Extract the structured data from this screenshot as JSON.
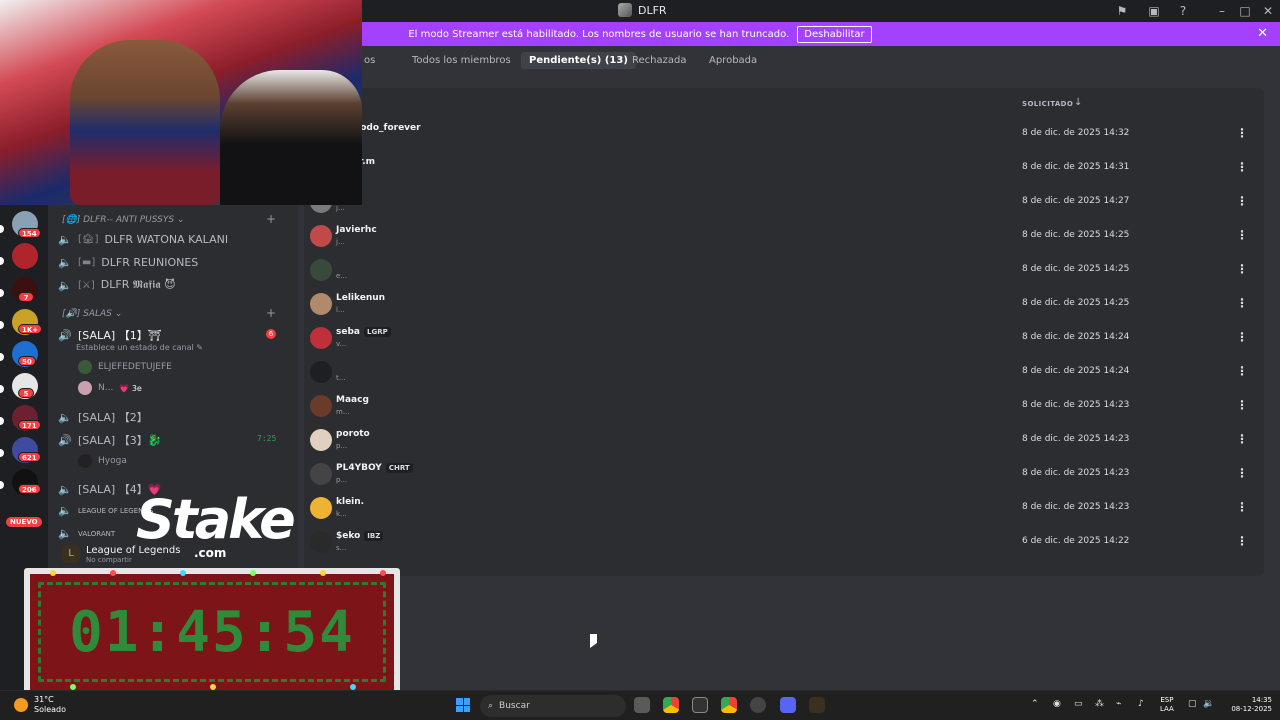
{
  "window": {
    "title": "DLFR"
  },
  "banner": {
    "message": "El modo Streamer está habilitado. Los nombres de usuario se han truncado.",
    "disable_label": "Deshabilitar"
  },
  "tabs": [
    {
      "label": "os"
    },
    {
      "label": "Todos los miembros"
    },
    {
      "label": "Pendiente(s) (13)",
      "active": true
    },
    {
      "label": "Rechazada"
    },
    {
      "label": "Aprobada"
    }
  ],
  "table": {
    "column_header": "SOLICITADO",
    "rows": [
      {
        "name": "pezgodo_forever",
        "sub": "",
        "date": "8 de dic. de 2025 14:32",
        "badge": ""
      },
      {
        "name": "ooo_r.m",
        "sub": "",
        "date": "8 de dic. de 2025 14:31",
        "badge": ""
      },
      {
        "name": "",
        "sub": "j...",
        "date": "8 de dic. de 2025 14:27",
        "badge": ""
      },
      {
        "name": "Javierhc",
        "sub": "j...",
        "date": "8 de dic. de 2025 14:25",
        "badge": ""
      },
      {
        "name": "",
        "sub": "e...",
        "date": "8 de dic. de 2025 14:25",
        "badge": ""
      },
      {
        "name": "Lelikenun",
        "sub": "l...",
        "date": "8 de dic. de 2025 14:25",
        "badge": ""
      },
      {
        "name": "seba",
        "sub": "v...",
        "date": "8 de dic. de 2025 14:24",
        "badge": "LGRP"
      },
      {
        "name": "",
        "sub": "t...",
        "date": "8 de dic. de 2025 14:24",
        "badge": ""
      },
      {
        "name": "Maacg",
        "sub": "m...",
        "date": "8 de dic. de 2025 14:23",
        "badge": ""
      },
      {
        "name": "poroto",
        "sub": "p...",
        "date": "8 de dic. de 2025 14:23",
        "badge": ""
      },
      {
        "name": "PL4YBOY",
        "sub": "p...",
        "date": "8 de dic. de 2025 14:23",
        "badge": "CHRT"
      },
      {
        "name": "klein.",
        "sub": "k...",
        "date": "8 de dic. de 2025 14:23",
        "badge": ""
      },
      {
        "name": "$eko",
        "sub": "s...",
        "date": "6 de dic. de 2025 14:22",
        "badge": "IBZ"
      }
    ]
  },
  "channels": {
    "category_1": "DLFR-- ANTI PUSSYS",
    "voice_1": [
      {
        "label": "DLFR WATONA KALANI",
        "tag": "[🏚]"
      },
      {
        "label": "DLFR REUNIONES",
        "tag": "[▬]"
      },
      {
        "label": "DLFR 𝕸𝖆𝖋𝖎𝖆 😈",
        "tag": "[⚔]"
      }
    ],
    "category_2": "SALAS",
    "sala1": {
      "label": "[SALA] 【1】⛩",
      "status": "Establece un estado de canal",
      "count": "6"
    },
    "sala1_members": [
      {
        "name": "ELJEFEDETUJEFE"
      },
      {
        "name": "N...",
        "extra": "💗 3e"
      }
    ],
    "sala2": {
      "label": "[SALA] 【2】"
    },
    "sala3": {
      "label": "[SALA] 【3】🐉",
      "time": "7:25"
    },
    "sala3_members": [
      {
        "name": "Hyoga"
      }
    ],
    "sala4": {
      "label": "[SALA] 【4】💗"
    },
    "lol_channel": {
      "label": "LEAGUE OF LEGENDS"
    },
    "valorant_channel": {
      "label": "VALORANT"
    }
  },
  "rail": {
    "badges": [
      "154",
      "7",
      "1K+",
      "50",
      "5",
      "171",
      "621",
      "206"
    ],
    "new_label": "NUEVO"
  },
  "activity": {
    "title": "League of Legends",
    "subtitle": "No compartir"
  },
  "overlay": {
    "brand": "Stake",
    "brand_suffix": ".com",
    "countdown": "01:45:54"
  },
  "taskbar": {
    "weather_temp": "31°C",
    "weather_desc": "Soleado",
    "search_label": "Buscar",
    "lang_1": "ESP",
    "lang_2": "LAA",
    "time": "14:35",
    "date": "08-12-2025"
  }
}
